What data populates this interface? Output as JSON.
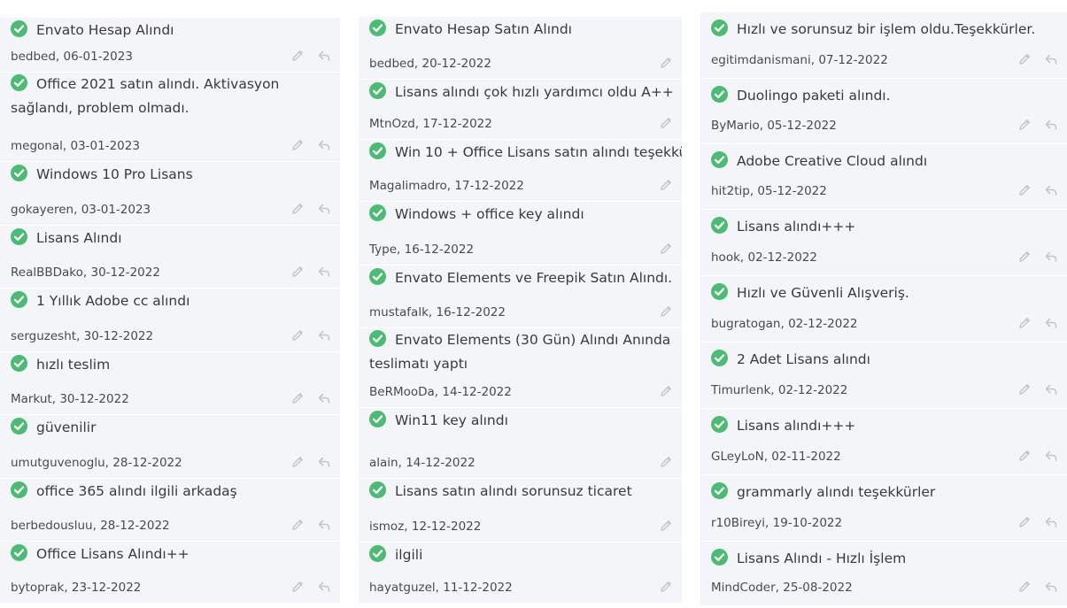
{
  "columns": [
    {
      "items": [
        {
          "title": "Envato Hesap Alındı",
          "author": "bedbed",
          "date": "06-01-2023",
          "reply": true
        },
        {
          "title": "Office 2021 satın alındı. Aktivasyon sağlandı, problem olmadı.",
          "author": "megonal",
          "date": "03-01-2023",
          "reply": true
        },
        {
          "title": "Windows 10 Pro Lisans",
          "author": "gokayeren",
          "date": "03-01-2023",
          "reply": true
        },
        {
          "title": "Lisans Alındı",
          "author": "RealBBDako",
          "date": "30-12-2022",
          "reply": true
        },
        {
          "title": "1 Yıllık Adobe cc alındı",
          "author": "serguzesht",
          "date": "30-12-2022",
          "reply": true
        },
        {
          "title": "hızlı teslim",
          "author": "Markut",
          "date": "30-12-2022",
          "reply": true
        },
        {
          "title": "güvenilir",
          "author": "umutguvenoglu",
          "date": "28-12-2022",
          "reply": true
        },
        {
          "title": "office 365 alındı ilgili arkadaş",
          "author": "berbedousluu",
          "date": "28-12-2022",
          "reply": true
        },
        {
          "title": "Office Lisans Alındı++",
          "author": "bytoprak",
          "date": "23-12-2022",
          "reply": true
        }
      ]
    },
    {
      "items": [
        {
          "title": "Envato Hesap Satın Alındı",
          "author": "bedbed",
          "date": "20-12-2022",
          "reply": false
        },
        {
          "title": "Lisans alındı çok hızlı yardımcı oldu A++",
          "author": "MtnOzd",
          "date": "17-12-2022",
          "reply": false
        },
        {
          "title": "Win 10 + Office Lisans satın alındı teşekkü",
          "author": "Magalimadro",
          "date": "17-12-2022",
          "reply": false
        },
        {
          "title": "Windows + office key alındı",
          "author": "Type",
          "date": "16-12-2022",
          "reply": false
        },
        {
          "title": "Envato Elements ve Freepik Satın Alındı.",
          "author": "mustafalk",
          "date": "16-12-2022",
          "reply": false
        },
        {
          "title": "Envato Elements (30 Gün) Alındı Anında teslimatı yaptı",
          "author": "BeRMooDa",
          "date": "14-12-2022",
          "reply": false
        },
        {
          "title": "Win11 key alındı",
          "author": "alain",
          "date": "14-12-2022",
          "reply": false
        },
        {
          "title": "Lisans satın alındı sorunsuz ticaret",
          "author": "ismoz",
          "date": "12-12-2022",
          "reply": false
        },
        {
          "title": "ilgili",
          "author": "hayatguzel",
          "date": "11-12-2022",
          "reply": false
        }
      ]
    },
    {
      "items": [
        {
          "title": "Hızlı ve sorunsuz bir işlem oldu.Teşekkürler.",
          "author": "egitimdanismani",
          "date": "07-12-2022",
          "reply": true
        },
        {
          "title": "Duolingo paketi alındı.",
          "author": "ByMario",
          "date": "05-12-2022",
          "reply": true
        },
        {
          "title": "Adobe Creative Cloud alındı",
          "author": "hit2tip",
          "date": "05-12-2022",
          "reply": true
        },
        {
          "title": "Lisans alındı+++",
          "author": "hook",
          "date": "02-12-2022",
          "reply": true
        },
        {
          "title": "Hızlı ve Güvenli Alışveriş.",
          "author": "bugratogan",
          "date": "02-12-2022",
          "reply": true
        },
        {
          "title": "2 Adet Lisans alındı",
          "author": "Timurlenk",
          "date": "02-12-2022",
          "reply": true
        },
        {
          "title": "Lisans alındı+++",
          "author": "GLeyLoN",
          "date": "02-11-2022",
          "reply": true
        },
        {
          "title": "grammarly alındı teşekkürler",
          "author": "r10Bireyi",
          "date": "19-10-2022",
          "reply": true
        },
        {
          "title": "Lisans Alındı - Hızlı İşlem",
          "author": "MindCoder",
          "date": "25-08-2022",
          "reply": true
        }
      ]
    }
  ],
  "colors": {
    "check": "#4cbb73",
    "panel": "#f3f5f8",
    "icon": "#c4c7cc"
  }
}
